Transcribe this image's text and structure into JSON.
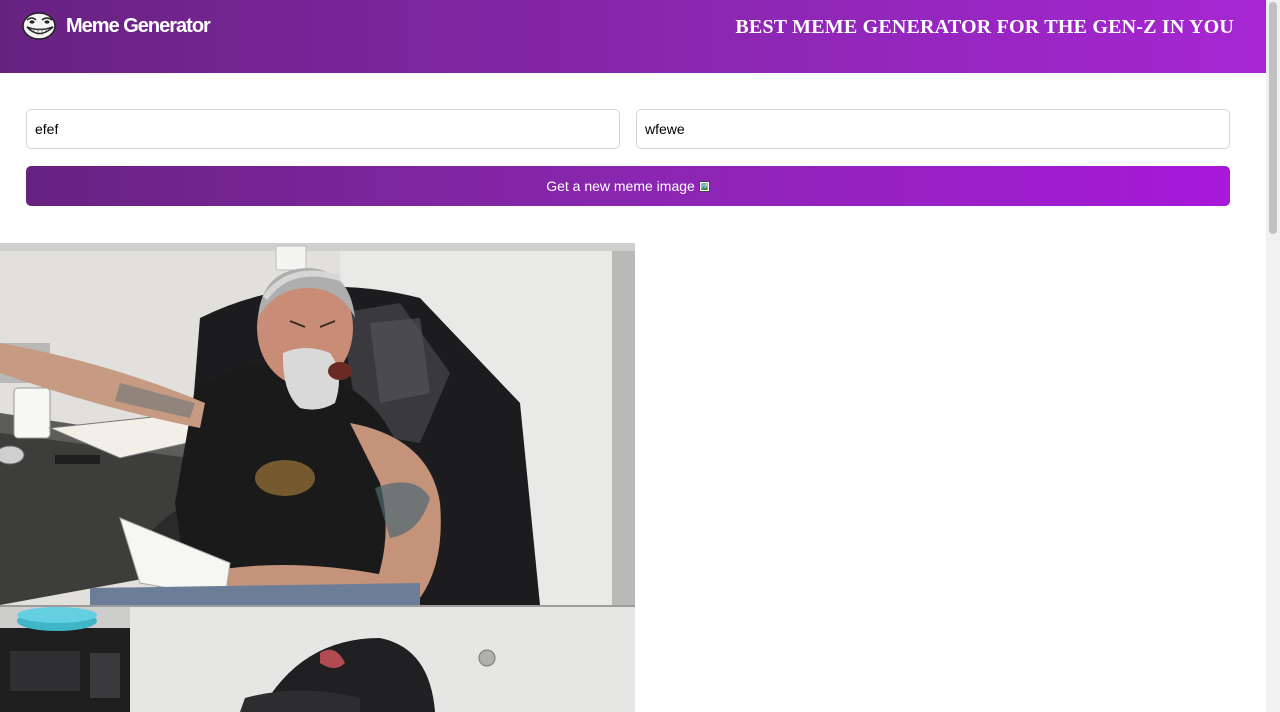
{
  "header": {
    "brand": "Meme Generator",
    "tagline": "BEST MEME GENERATOR FOR THE GEN-Z IN YOU",
    "logo_icon": "troll-face-icon"
  },
  "form": {
    "top_text": "efef",
    "bottom_text": "wfewe",
    "button_label": "Get a new meme image",
    "button_icon": "framed-picture-icon"
  },
  "meme": {
    "image_icon": "meme-image",
    "description_icon": "american-chopper-argument"
  },
  "colors": {
    "accent_start": "#672280",
    "accent_end": "#a626d3",
    "text_on_accent": "#ffffff"
  }
}
